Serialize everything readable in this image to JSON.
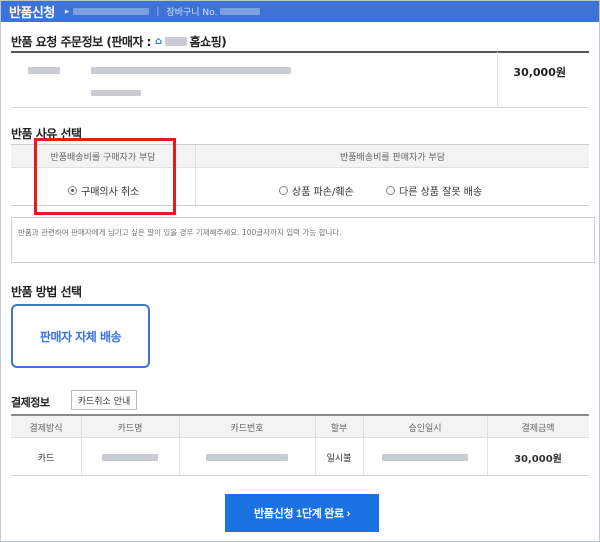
{
  "header": {
    "title": "반품신청",
    "arrow": "▸",
    "cart_label": "장바구니 No."
  },
  "order_info": {
    "title": "반품 요청 주문정보 (판매자 :",
    "seller_suffix": "홈쇼핑)",
    "seller_icon": "home-icon",
    "price": "30,000원"
  },
  "reason": {
    "title": "반품 사유 선택",
    "buyer_header": "반품배송비를 구매자가 부담",
    "seller_header": "반품배송비를 판매자가 부담",
    "options": {
      "buyer_change_mind": "구매의사 취소",
      "damaged": "상품 파손/훼손",
      "wrong_item": "다른 상품 잘못 배송"
    },
    "selected": "buyer_change_mind",
    "memo_placeholder": "반품과 관련하여 판매자에게 남기고 싶은 말이 있을 경우 기재해주세요. 100글자까지 입력 가능 합니다.",
    "highlight_color": "#e41b23"
  },
  "method": {
    "title": "반품 방법 선택",
    "option": "판매자 자체 배송"
  },
  "payment": {
    "title": "결제정보",
    "card_guide_button": "카드취소 안내",
    "columns": [
      "결제방식",
      "카드명",
      "카드번호",
      "할부",
      "승인일시",
      "결제금액"
    ],
    "row": {
      "method": "카드",
      "installment": "일시불",
      "amount": "30,000원"
    }
  },
  "submit_button": "반품신청 1단계 완료 ›",
  "colors": {
    "accent": "#3d73d6",
    "button": "#1a72e0"
  }
}
